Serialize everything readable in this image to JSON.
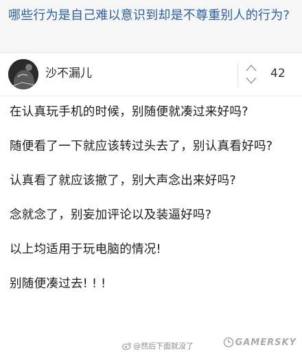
{
  "question": {
    "title": "哪些行为是自己难以意识到却是不尊重别人的行为?"
  },
  "answer": {
    "author": "沙不漏儿",
    "vote_count": "42",
    "lines": [
      "在认真玩手机的时候，别随便就凑过来好吗?",
      "随便看了一下就应该转过头去了，别认真看好吗?",
      "认真看了就应该撤了，别大声念出来好吗?",
      "念就念了，别妄加评论以及装逼好吗?",
      "以上均适用于玩电脑的情况!",
      "别随便凑过去! ! !"
    ]
  },
  "credit": {
    "weibo_handle": "@然后下面就没了"
  },
  "watermark": {
    "text": "GAMERSKY"
  }
}
